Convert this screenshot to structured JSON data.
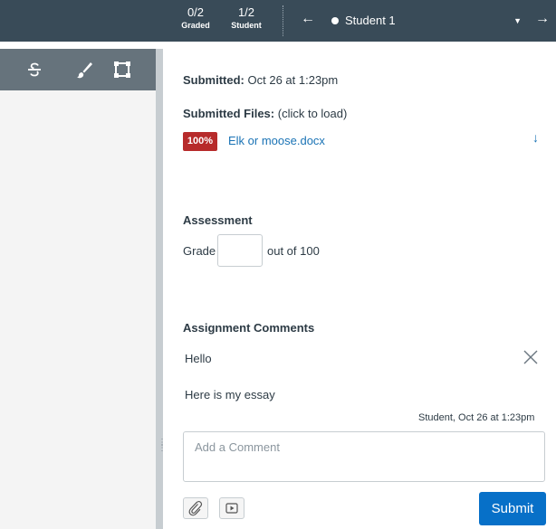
{
  "header": {
    "graded": {
      "count": "0/2",
      "label": "Graded"
    },
    "student": {
      "count": "1/2",
      "label": "Student"
    },
    "prev_icon": "left-arrow-icon",
    "next_icon": "right-arrow-icon",
    "selected_student": "Student 1"
  },
  "toolbar": {
    "tools": [
      "strikethrough-icon",
      "brush-icon",
      "rectangle-icon"
    ]
  },
  "submission": {
    "submitted_label": "Submitted:",
    "submitted_value": "Oct 26 at 1:23pm",
    "files_label": "Submitted Files:",
    "files_hint": "(click to load)",
    "file": {
      "badge": "100%",
      "name": "Elk or moose.docx"
    },
    "download_icon": "download-arrow-icon"
  },
  "assessment": {
    "heading": "Assessment",
    "grade_label": "Grade",
    "grade_value": "",
    "out_of": "out of 100"
  },
  "comments": {
    "heading": "Assignment Comments",
    "items": [
      {
        "text": "Hello"
      },
      {
        "text": "Here is my essay",
        "meta": "Student, Oct 26 at 1:23pm"
      }
    ],
    "placeholder": "Add a Comment",
    "submit_label": "Submit"
  },
  "colors": {
    "topbar": "#394b58",
    "toolbar": "#66737c",
    "badge": "#b72b2b",
    "link": "#1a73b5",
    "submit": "#0770c8"
  }
}
